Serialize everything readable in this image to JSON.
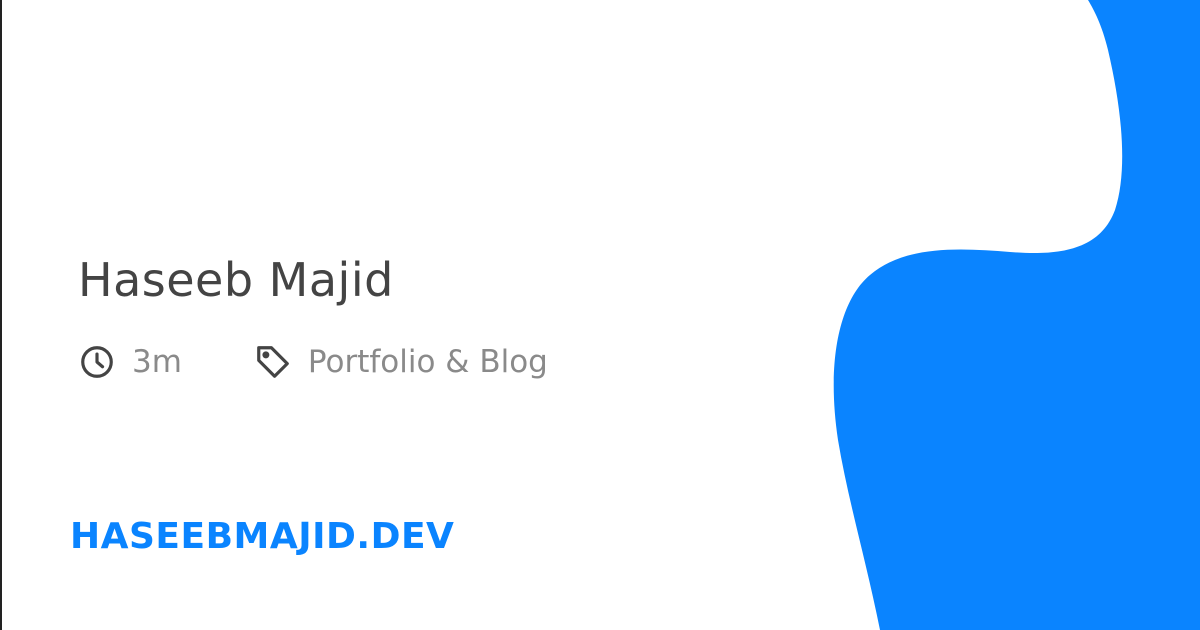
{
  "card": {
    "title": "Haseeb Majid",
    "meta": {
      "reading_time": "3m",
      "category": "Portfolio & Blog",
      "time_icon": "clock-icon",
      "category_icon": "tag-icon"
    },
    "site": "HASEEBMAJID.DEV"
  },
  "colors": {
    "accent": "#0a84ff",
    "title": "#444444",
    "meta": "#8a8a8a",
    "background": "#ffffff"
  }
}
